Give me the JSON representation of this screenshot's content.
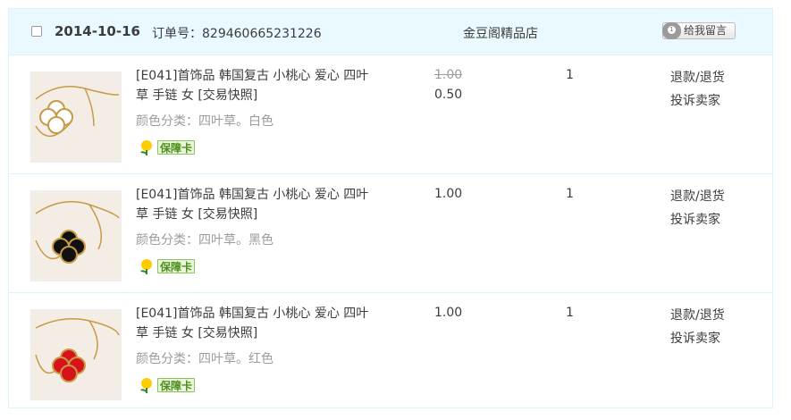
{
  "order": {
    "date": "2014-10-16",
    "order_no_text": "订单号：829460665231226",
    "shop_name": "金豆阁精品店",
    "message_button_label": "给我留言",
    "message_icon_text": "1"
  },
  "items": [
    {
      "title": "[E041]首饰品 韩国复古 小桃心 爱心 四叶草 手链 女 [交易快照]",
      "spec": "颜色分类：四叶草。白色",
      "badge": "保障卡",
      "original_price": "1.00",
      "price": "0.50",
      "quantity": "1",
      "action_refund": "退款/退货",
      "action_complain": "投诉卖家",
      "gem_color": "#ffffff"
    },
    {
      "title": "[E041]首饰品 韩国复古 小桃心 爱心 四叶草 手链 女 [交易快照]",
      "spec": "颜色分类：四叶草。黑色",
      "badge": "保障卡",
      "price": "1.00",
      "quantity": "1",
      "action_refund": "退款/退货",
      "action_complain": "投诉卖家",
      "gem_color": "#111111"
    },
    {
      "title": "[E041]首饰品 韩国复古 小桃心 爱心 四叶草 手链 女 [交易快照]",
      "spec": "颜色分类：四叶草。红色",
      "badge": "保障卡",
      "price": "1.00",
      "quantity": "1",
      "action_refund": "退款/退货",
      "action_complain": "投诉卖家",
      "gem_color": "#d8121a"
    }
  ]
}
